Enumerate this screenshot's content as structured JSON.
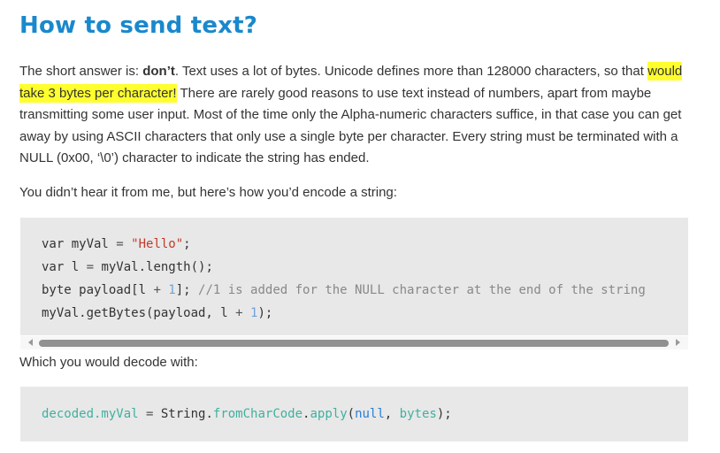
{
  "heading": "How to send text?",
  "p1": {
    "lead": "The short answer is: ",
    "bold": "don’t",
    "after_bold": ". Text uses a lot of bytes. Unicode defines more than 128000 characters, so that ",
    "highlighted": "would take 3 bytes per character!",
    "rest": " There are rarely good reasons to use text instead of numbers, apart from maybe transmitting some user input. Most of the time only the Alpha-numeric characters suffice, in that case you can get away by using ASCII characters that only use a single byte per character. Every string must be terminated with a NULL (0x00, ‘\\0’) character to indicate the string has ended."
  },
  "p2": "You didn’t hear it from me, but here’s how you’d encode a string:",
  "code1": {
    "l1": {
      "kw": "var ",
      "name": "myVal ",
      "op": "= ",
      "str": "\"Hello\"",
      "end": ";"
    },
    "l2": {
      "kw": "var ",
      "name": "l ",
      "op": "= ",
      "rest": "myVal.length();"
    },
    "l3": {
      "a": "byte payload[l ",
      "op": "+ ",
      "num": "1",
      "b": "]; ",
      "cmt": "//1 is added for the NULL character at the end of the string"
    },
    "l4": {
      "a": "myVal.getBytes(payload, l ",
      "op": "+ ",
      "num": "1",
      "b": ");"
    }
  },
  "p3": "Which you would decode with:",
  "code2": {
    "a": "decoded.myVal",
    "op": " = ",
    "b": "String.",
    "c": "fromCharCode",
    "d": ".",
    "e": "apply",
    "f": "(",
    "g": "null",
    "h": ", ",
    "i": "bytes",
    "j": ");"
  },
  "colors": {
    "heading": "#1a88cc",
    "highlight": "#ffff2e",
    "code_bg": "#e8e8e8"
  }
}
